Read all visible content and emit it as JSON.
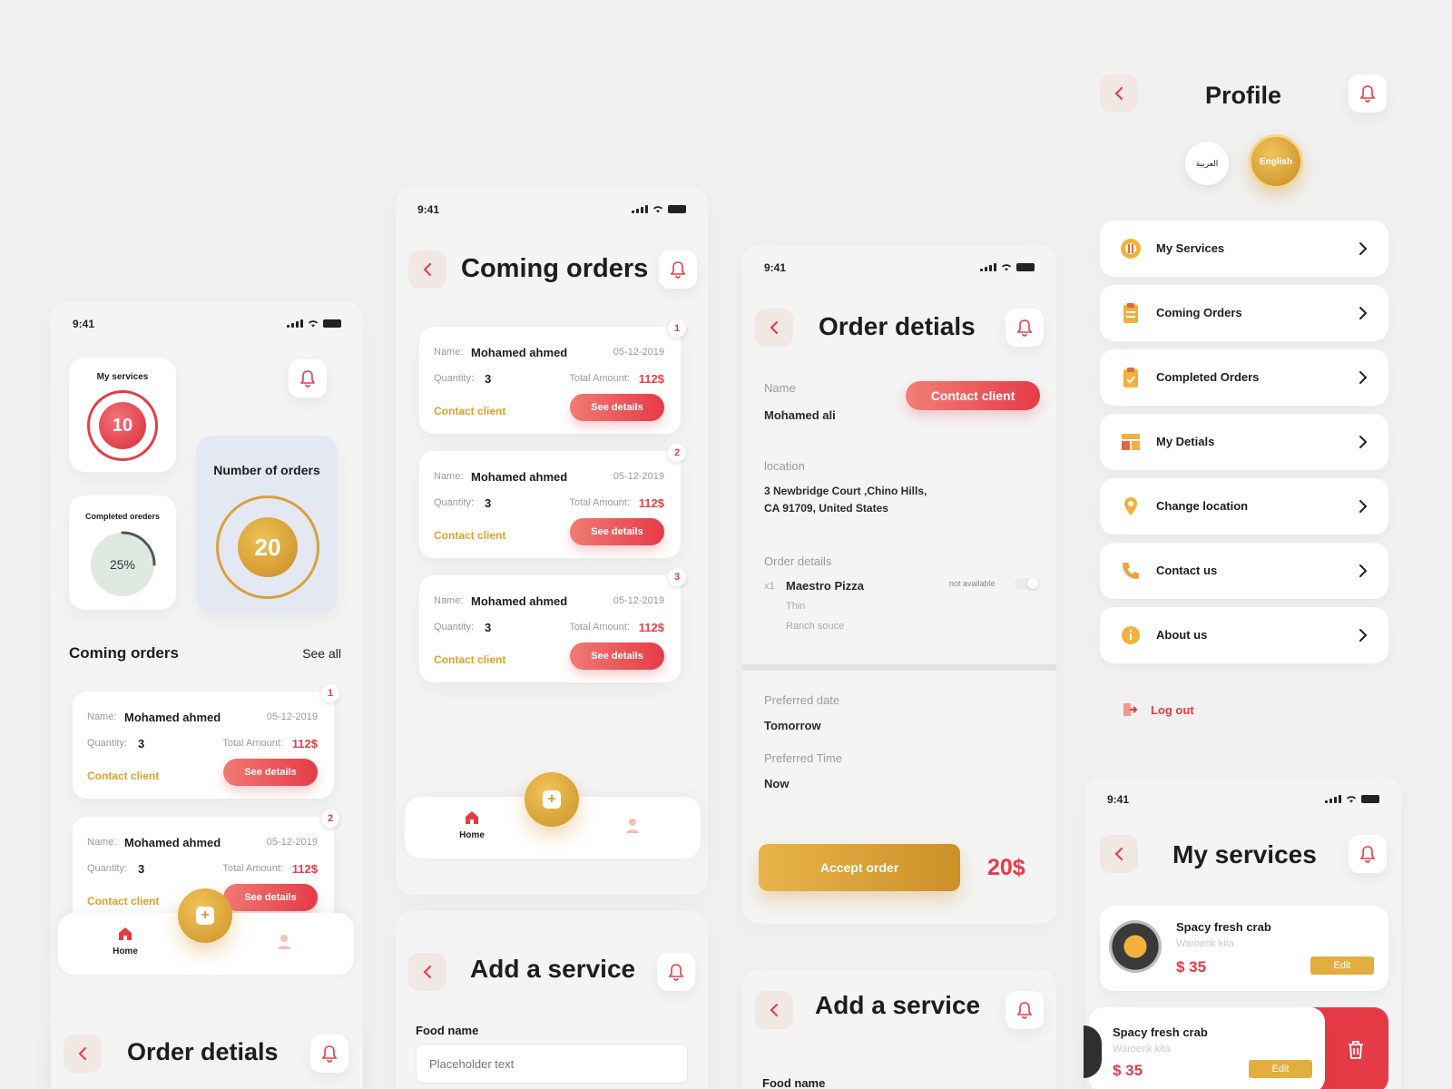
{
  "status_time": "9:41",
  "home": {
    "my_services_label": "My services",
    "my_services_count": "10",
    "completed_label": "Completed oreders",
    "completed_percent": "25%",
    "completed_fraction": 0.25,
    "orders_label": "Number of orders",
    "orders_count": "20",
    "coming_orders_title": "Coming orders",
    "see_all": "See all"
  },
  "order_card": {
    "name_label": "Name:",
    "name": "Mohamed ahmed",
    "date": "05-12-2019",
    "quantity_label": "Quantity:",
    "quantity": "3",
    "total_label": "Total Amount:",
    "total": "112$",
    "contact": "Contact client",
    "see_details": "See details"
  },
  "badges": [
    "1",
    "2",
    "3"
  ],
  "nav": {
    "home_label": "Home"
  },
  "coming_orders": {
    "title": "Coming orders"
  },
  "order_details": {
    "title": "Order detials",
    "name_label": "Name",
    "name": "Mohamed ali",
    "contact_button": "Contact client",
    "location_label": "location",
    "address_line1": "3 Newbridge Court ,Chino Hills,",
    "address_line2": "CA 91709, United States",
    "order_details_label": "Order details",
    "item_qty": "x1",
    "item_name": "Maestro Pizza",
    "item_opt1": "Thin",
    "item_opt2": "Ranch souce",
    "availability": "not available",
    "preferred_date_label": "Preferred date",
    "preferred_date": "Tomorrow",
    "preferred_time_label": "Preferred Time",
    "preferred_time": "Now",
    "accept_button": "Accept order",
    "price": "20$"
  },
  "add_service": {
    "title": "Add a service",
    "food_name_label": "Food name",
    "placeholder": "Placeholder text"
  },
  "profile": {
    "title": "Profile",
    "lang_ar": "العربية",
    "lang_en": "English",
    "menu": [
      {
        "label": "My Services",
        "icon": "services-icon"
      },
      {
        "label": "Coming Orders",
        "icon": "clipboard-icon"
      },
      {
        "label": "Completed Orders",
        "icon": "clipboard-check-icon"
      },
      {
        "label": "My Detials",
        "icon": "details-icon"
      },
      {
        "label": "Change location",
        "icon": "location-pin-icon"
      },
      {
        "label": "Contact us",
        "icon": "phone-icon"
      },
      {
        "label": "About us",
        "icon": "info-icon"
      }
    ],
    "logout": "Log out"
  },
  "my_services": {
    "title": "My services",
    "items": [
      {
        "name": "Spacy fresh crab",
        "subtitle": "Waroenk kita",
        "price": "$ 35",
        "edit": "Edit"
      },
      {
        "name": "Spacy fresh crab",
        "subtitle": "Waroenk kita",
        "price": "$ 35",
        "edit": "Edit"
      }
    ]
  },
  "colors": {
    "accent_red": "#e63b47",
    "accent_gold": "#d59c2d",
    "background": "#f1f1f1"
  }
}
